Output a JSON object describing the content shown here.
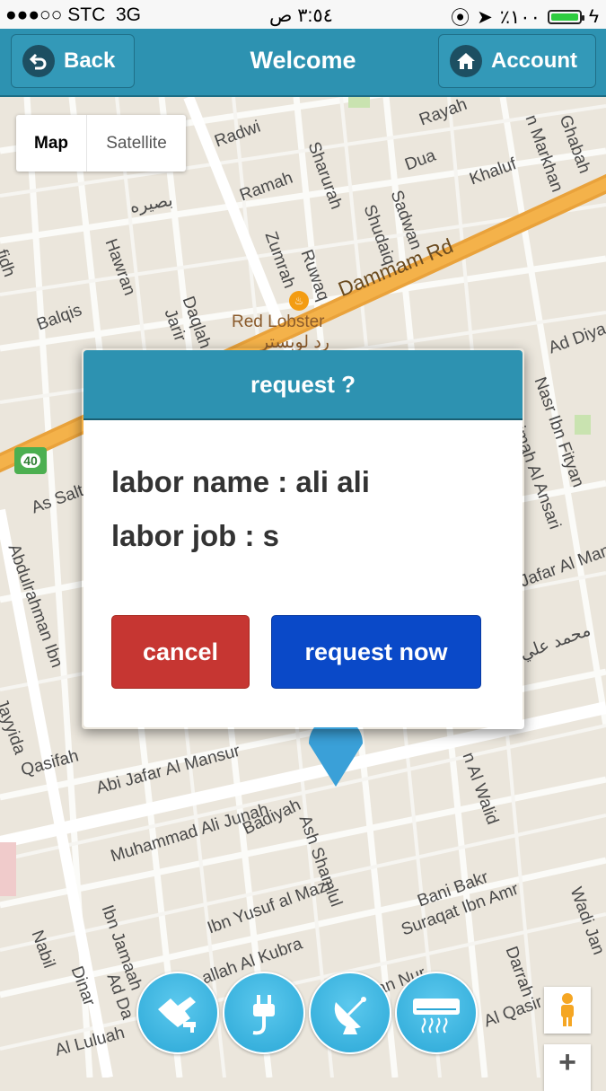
{
  "status_bar": {
    "signal": "●●●○○",
    "carrier": "STC",
    "network": "3G",
    "time": "٣:٥٤ ص",
    "battery_percent": "٪١٠٠"
  },
  "nav": {
    "back_label": "Back",
    "title": "Welcome",
    "account_label": "Account"
  },
  "map": {
    "type_map": "Map",
    "type_satellite": "Satellite",
    "labels": {
      "radwi": "Radwi",
      "rayah": "Rayah",
      "markhan": "n Markhan",
      "ghabah": "Ghabah",
      "sharurah": "Sharurah",
      "dua": "Dua",
      "khaluf": "Khaluf",
      "ramah": "Ramah",
      "sadwan": "Sadwan",
      "shudaiq": "Shudaiq",
      "hawran": "Hawran",
      "zumrah": "Zumrah",
      "ruwaq": "Ruwaq",
      "dammam_rd": "Dammam Rd",
      "daqlah": "Daqlah",
      "jarir": "Jarir",
      "balqis": "Balqis",
      "red_lobster": "Red Lobster",
      "red_lobster_ar": "رد لوبستر",
      "ad_diya": "Ad Diya",
      "nasr_ibn_fityan": "Nasr Ibn Fityan",
      "khazimah": "Khazimah Al Ansari",
      "as_salt": "As Salt",
      "abdulrahman": "Abdulrahman Ibn",
      "jafar_al_man": "Jafar Al Man",
      "muhammad_ali_ar": "محمد علي",
      "jayyida": "Jayyida",
      "qasifah": "Qasifah",
      "abi_jafar": "Abi Jafar Al Mansur",
      "muhammad_ali_junah": "Muhammad Ali Junah",
      "badiyah": "Badiyah",
      "ash_shamlul": "Ash Shamlul",
      "al_walid": "n Al Walid",
      "bani_bakr": "Bani Bakr",
      "suraqat": "Suraqat Ibn Amr",
      "ibn_yusuf": "Ibn Yusuf al Mazi",
      "ibn_jamaah": "Ibn Jamaah",
      "nabil": "Nabil",
      "dinar": "Dinar",
      "ad_da": "Ad Da",
      "allah_al_kubra": "allah Al Kubra",
      "darrah": "Darrah",
      "wadi_jan": "Wadi Jan",
      "al_qasir": "Al Qasir",
      "al_luluah": "Al Luluah",
      "an_nur": "an Nur",
      "route_40": "40",
      "fidh": "fidh",
      "basira_ar": "بصيره"
    }
  },
  "dialog": {
    "title": "request ?",
    "labor_name": "labor name : ali ali",
    "labor_job": "labor job : s",
    "cancel_label": "cancel",
    "request_label": "request now"
  },
  "colors": {
    "header": "#2d92b1",
    "cancel": "#c63632",
    "request": "#0a49c8",
    "service": "#2aa7d6"
  }
}
